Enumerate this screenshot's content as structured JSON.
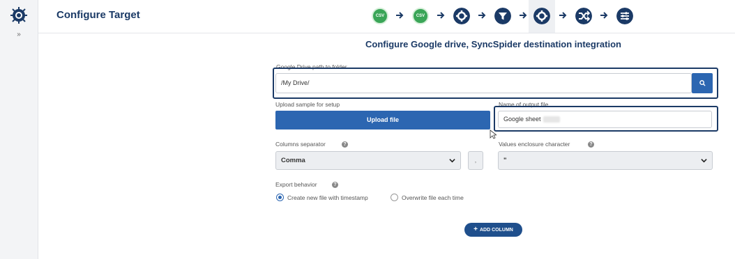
{
  "header": {
    "title": "Configure Target",
    "steps": [
      {
        "type": "csv",
        "label": "CSV",
        "icon": "csv-icon"
      },
      {
        "type": "csv",
        "label": "CSV",
        "icon": "csv-icon"
      },
      {
        "type": "settings",
        "icon": "gear-icon"
      },
      {
        "type": "filter",
        "icon": "filter-icon"
      },
      {
        "type": "settings",
        "icon": "gear-icon",
        "active": true
      },
      {
        "type": "shuffle",
        "icon": "shuffle-icon"
      },
      {
        "type": "sliders",
        "icon": "sliders-icon"
      }
    ]
  },
  "sidebar": {
    "expand_label": "»"
  },
  "main": {
    "heading": "Configure Google drive, SyncSpider destination integration",
    "drive_path": {
      "label": "Google Drive path to folder",
      "value": "/My Drive/"
    },
    "upload": {
      "label": "Upload sample for setup",
      "button": "Upload file"
    },
    "output_file": {
      "label": "Name of output file",
      "value": "Google sheet"
    },
    "columns_separator": {
      "label": "Columns separator",
      "value": "Comma",
      "custom_value": ","
    },
    "enclosure": {
      "label": "Values enclosure character",
      "value": "\""
    },
    "export_behavior": {
      "label": "Export behavior",
      "options": [
        {
          "label": "Create new file with timestamp",
          "selected": true
        },
        {
          "label": "Overwrite file each time",
          "selected": false
        }
      ]
    },
    "add_column": {
      "label": "ADD COLUMN",
      "icon": "+"
    }
  },
  "colors": {
    "accent": "#2c66b1",
    "navy": "#1b3a66",
    "green": "#3aa557"
  }
}
